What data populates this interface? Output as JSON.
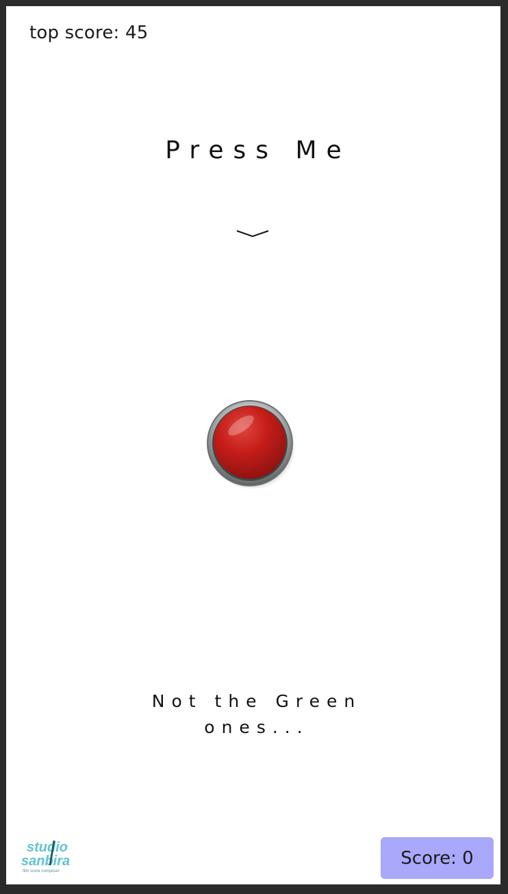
{
  "top_score": {
    "text": "top score: 45",
    "value": 45
  },
  "title": "Press Me",
  "hint": {
    "line1": "Not the Green",
    "line2": "ones..."
  },
  "score": {
    "text": "Score: 0",
    "value": 0
  },
  "logo": {
    "line1": "studio",
    "line2": "sanbira",
    "tagline": "film score composer"
  },
  "colors": {
    "button_red": "#c61d19",
    "score_box": "#a9a8fb",
    "logo_teal": "#5fc4cf",
    "frame": "#2b2b2b"
  }
}
